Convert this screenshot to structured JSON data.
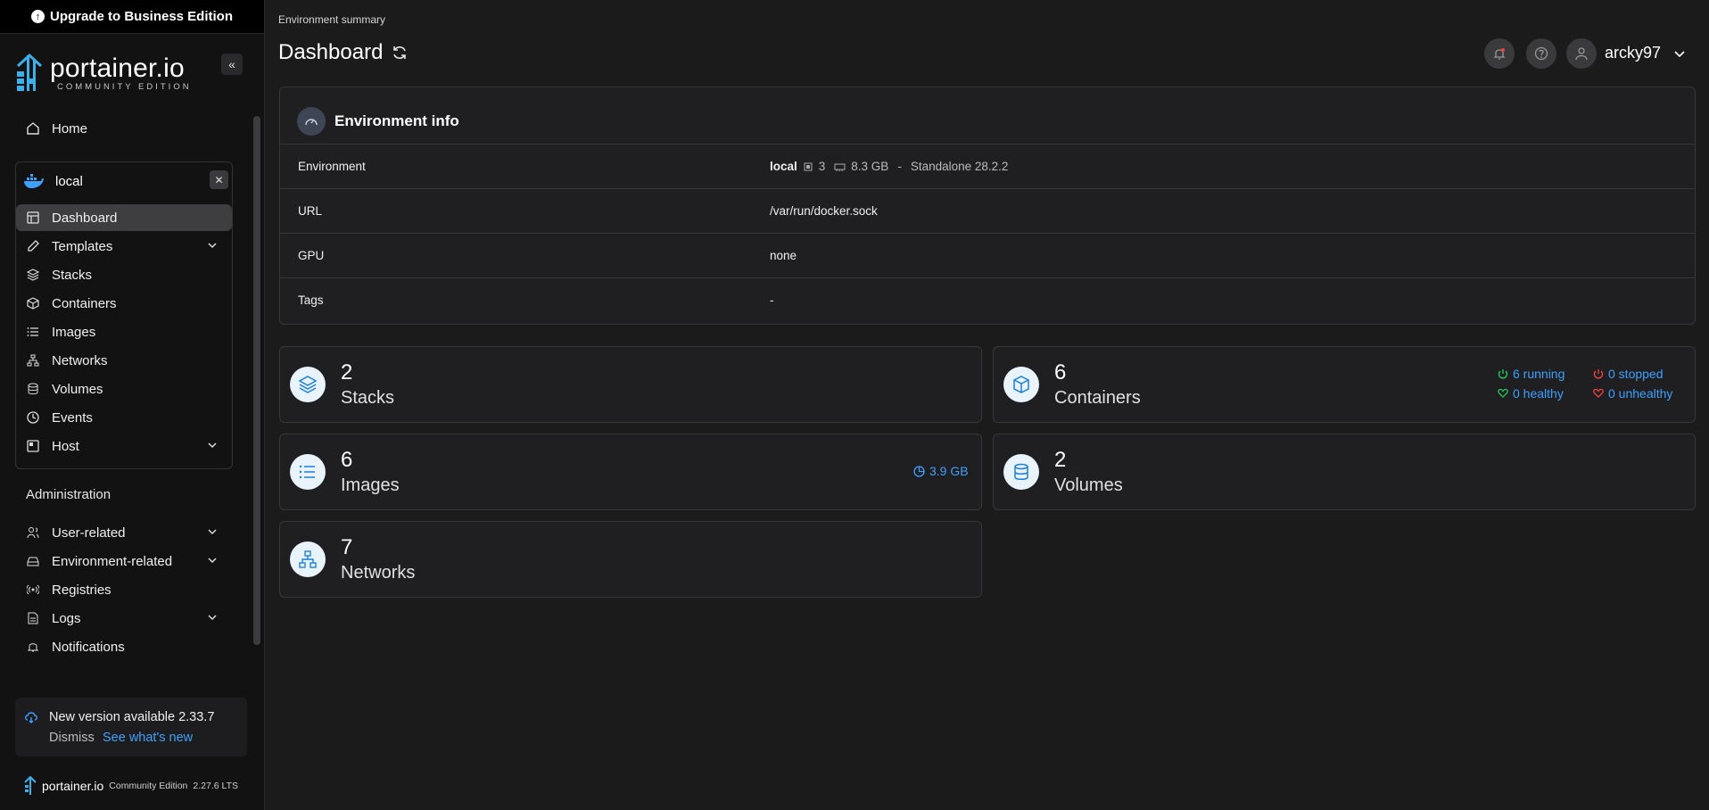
{
  "upgrade_banner": "Upgrade to Business Edition",
  "logo": {
    "name": "portainer.io",
    "edition": "COMMUNITY EDITION"
  },
  "sidebar": {
    "home": "Home",
    "environment": {
      "name": "local"
    },
    "env_items": [
      "Dashboard",
      "Templates",
      "Stacks",
      "Containers",
      "Images",
      "Networks",
      "Volumes",
      "Events",
      "Host"
    ],
    "admin_label": "Administration",
    "admin_items": [
      "User-related",
      "Environment-related",
      "Registries",
      "Logs",
      "Notifications"
    ]
  },
  "update": {
    "title": "New version available 2.33.7",
    "dismiss": "Dismiss",
    "whats_new": "See what's new"
  },
  "footer": {
    "brand": "portainer.io",
    "edition": "Community Edition",
    "version": "2.27.6 LTS"
  },
  "header": {
    "breadcrumb": "Environment summary",
    "title": "Dashboard",
    "user": "arcky97"
  },
  "env_info": {
    "title": "Environment info",
    "rows": [
      {
        "key": "Environment",
        "env_name": "local",
        "cpu": "3",
        "mem": "8.3 GB",
        "sep": "-",
        "type": "Standalone 28.2.2"
      },
      {
        "key": "URL",
        "value": "/var/run/docker.sock"
      },
      {
        "key": "GPU",
        "value": "none"
      },
      {
        "key": "Tags",
        "value": "-"
      }
    ]
  },
  "stats": {
    "stacks": {
      "count": "2",
      "label": "Stacks"
    },
    "containers": {
      "count": "6",
      "label": "Containers",
      "running": "6 running",
      "stopped": "0 stopped",
      "healthy": "0 healthy",
      "unhealthy": "0 unhealthy"
    },
    "images": {
      "count": "6",
      "label": "Images",
      "size": "3.9 GB"
    },
    "volumes": {
      "count": "2",
      "label": "Volumes"
    },
    "networks": {
      "count": "7",
      "label": "Networks"
    }
  },
  "colors": {
    "accent": "#3ea0ff",
    "running": "#22c55e",
    "stopped": "#ef4444"
  }
}
